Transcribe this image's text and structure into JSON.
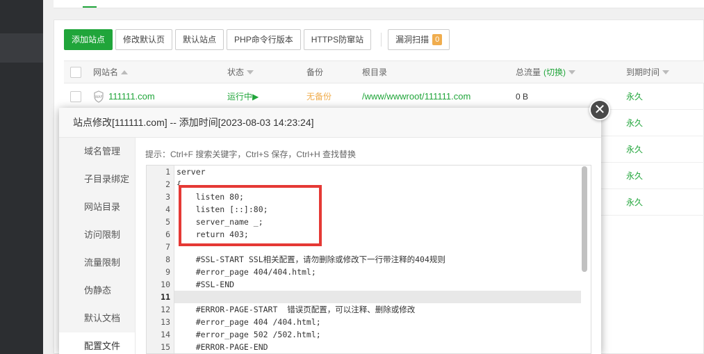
{
  "toolbar": {
    "add_site": "添加站点",
    "edit_default_page": "修改默认页",
    "default_site": "默认站点",
    "php_cli_version": "PHP命令行版本",
    "https_firewall": "HTTPS防窜站",
    "vuln_scan": "漏洞扫描",
    "vuln_count": "0"
  },
  "table": {
    "headers": {
      "site_name": "网站名",
      "status": "状态",
      "backup": "备份",
      "root_dir": "根目录",
      "traffic": "总流量",
      "traffic_switch": "(切换)",
      "expire": "到期时间"
    },
    "rows": [
      {
        "name": "111111.com",
        "status": "运行中▶",
        "backup": "无备份",
        "root": "/www/wwwroot/111111.com",
        "traffic": "0 B",
        "expire": "永久"
      },
      {
        "expire": "永久"
      },
      {
        "expire": "永久"
      },
      {
        "expire": "永久"
      },
      {
        "expire": "永久"
      }
    ]
  },
  "modal": {
    "title": "站点修改[111111.com] -- 添加时间[2023-08-03 14:23:24]",
    "close_symbol": "✕",
    "hint": "提示：Ctrl+F 搜索关键字，Ctrl+S 保存，Ctrl+H 查找替换",
    "nav": [
      "域名管理",
      "子目录绑定",
      "网站目录",
      "访问限制",
      "流量限制",
      "伪静态",
      "默认文档",
      "配置文件"
    ],
    "active_nav_index": 7
  },
  "editor": {
    "active_line": 11,
    "lines": [
      {
        "n": "1",
        "text": "server",
        "cls": "kw"
      },
      {
        "n": "2",
        "text": "{",
        "cls": ""
      },
      {
        "n": "3",
        "text": "    listen 80;",
        "cls": ""
      },
      {
        "n": "4",
        "text": "    listen [::]:80;",
        "cls": "kw"
      },
      {
        "n": "5",
        "text": "    server_name _;",
        "cls": "kw"
      },
      {
        "n": "6",
        "text": "    return 403;",
        "cls": "kw"
      },
      {
        "n": "7",
        "text": "",
        "cls": ""
      },
      {
        "n": "8",
        "text": "    #SSL-START SSL相关配置，请勿删除或修改下一行带注释的404规则",
        "cls": "cm"
      },
      {
        "n": "9",
        "text": "    #error_page 404/404.html;",
        "cls": "cm"
      },
      {
        "n": "10",
        "text": "    #SSL-END",
        "cls": "cm"
      },
      {
        "n": "11",
        "text": "",
        "cls": ""
      },
      {
        "n": "12",
        "text": "    #ERROR-PAGE-START  错误页配置，可以注释、删除或修改",
        "cls": "cm"
      },
      {
        "n": "13",
        "text": "    #error_page 404 /404.html;",
        "cls": "cm"
      },
      {
        "n": "14",
        "text": "    #error_page 502 /502.html;",
        "cls": "cm"
      },
      {
        "n": "15",
        "text": "    #ERROR-PAGE-END",
        "cls": "cm"
      }
    ]
  },
  "colors": {
    "accent_green": "#20a53a",
    "warning_orange": "#f0ad4e",
    "highlight_red": "#e53935"
  }
}
